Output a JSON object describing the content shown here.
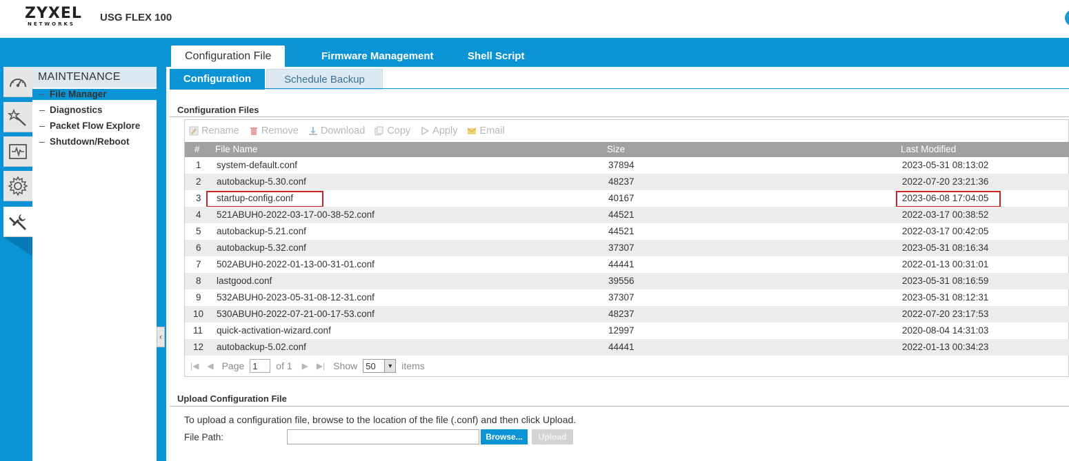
{
  "header": {
    "logo_main": "ZYXEL",
    "logo_sub": "NETWORKS",
    "product": "USG FLEX 100"
  },
  "top_tabs": [
    "Configuration File",
    "Firmware Management",
    "Shell Script"
  ],
  "sidebar": {
    "icons": [
      "dashboard-icon",
      "wizard-icon",
      "monitor-icon",
      "configuration-icon",
      "maintenance-icon"
    ],
    "title": "MAINTENANCE",
    "items": [
      {
        "label": "File Manager",
        "active": true
      },
      {
        "label": "Diagnostics"
      },
      {
        "label": "Packet Flow Explore"
      },
      {
        "label": "Shutdown/Reboot"
      }
    ]
  },
  "sub_tabs": [
    "Configuration",
    "Schedule Backup"
  ],
  "config_files": {
    "section_title": "Configuration Files",
    "toolbar": [
      "Rename",
      "Remove",
      "Download",
      "Copy",
      "Apply",
      "Email"
    ],
    "columns": [
      "#",
      "File Name",
      "Size",
      "Last Modified"
    ],
    "rows": [
      {
        "num": "1",
        "name": "system-default.conf",
        "size": "37894",
        "modified": "2023-05-31 08:13:02"
      },
      {
        "num": "2",
        "name": "autobackup-5.30.conf",
        "size": "48237",
        "modified": "2022-07-20 23:21:36"
      },
      {
        "num": "3",
        "name": "startup-config.conf",
        "size": "40167",
        "modified": "2023-06-08 17:04:05"
      },
      {
        "num": "4",
        "name": "521ABUH0-2022-03-17-00-38-52.conf",
        "size": "44521",
        "modified": "2022-03-17 00:38:52"
      },
      {
        "num": "5",
        "name": "autobackup-5.21.conf",
        "size": "44521",
        "modified": "2022-03-17 00:42:05"
      },
      {
        "num": "6",
        "name": "autobackup-5.32.conf",
        "size": "37307",
        "modified": "2023-05-31 08:16:34"
      },
      {
        "num": "7",
        "name": "502ABUH0-2022-01-13-00-31-01.conf",
        "size": "44441",
        "modified": "2022-01-13 00:31:01"
      },
      {
        "num": "8",
        "name": "lastgood.conf",
        "size": "39556",
        "modified": "2023-05-31 08:16:59"
      },
      {
        "num": "9",
        "name": "532ABUH0-2023-05-31-08-12-31.conf",
        "size": "37307",
        "modified": "2023-05-31 08:12:31"
      },
      {
        "num": "10",
        "name": "530ABUH0-2022-07-21-00-17-53.conf",
        "size": "48237",
        "modified": "2022-07-20 23:17:53"
      },
      {
        "num": "11",
        "name": "quick-activation-wizard.conf",
        "size": "12997",
        "modified": "2020-08-04 14:31:03"
      },
      {
        "num": "12",
        "name": "autobackup-5.02.conf",
        "size": "44441",
        "modified": "2022-01-13 00:34:23"
      }
    ],
    "pager": {
      "page_label": "Page",
      "page_value": "1",
      "of_label": "of 1",
      "show_label": "Show",
      "page_size": "50",
      "items_label": "items"
    }
  },
  "upload": {
    "section_title": "Upload Configuration File",
    "instructions": "To upload a configuration file, browse to the location of the file (.conf) and then click Upload.",
    "file_path_label": "File Path:",
    "file_path_value": "",
    "browse_label": "Browse...",
    "upload_label": "Upload"
  },
  "colors": {
    "accent": "#0a94d6",
    "highlight": "#d42020"
  }
}
